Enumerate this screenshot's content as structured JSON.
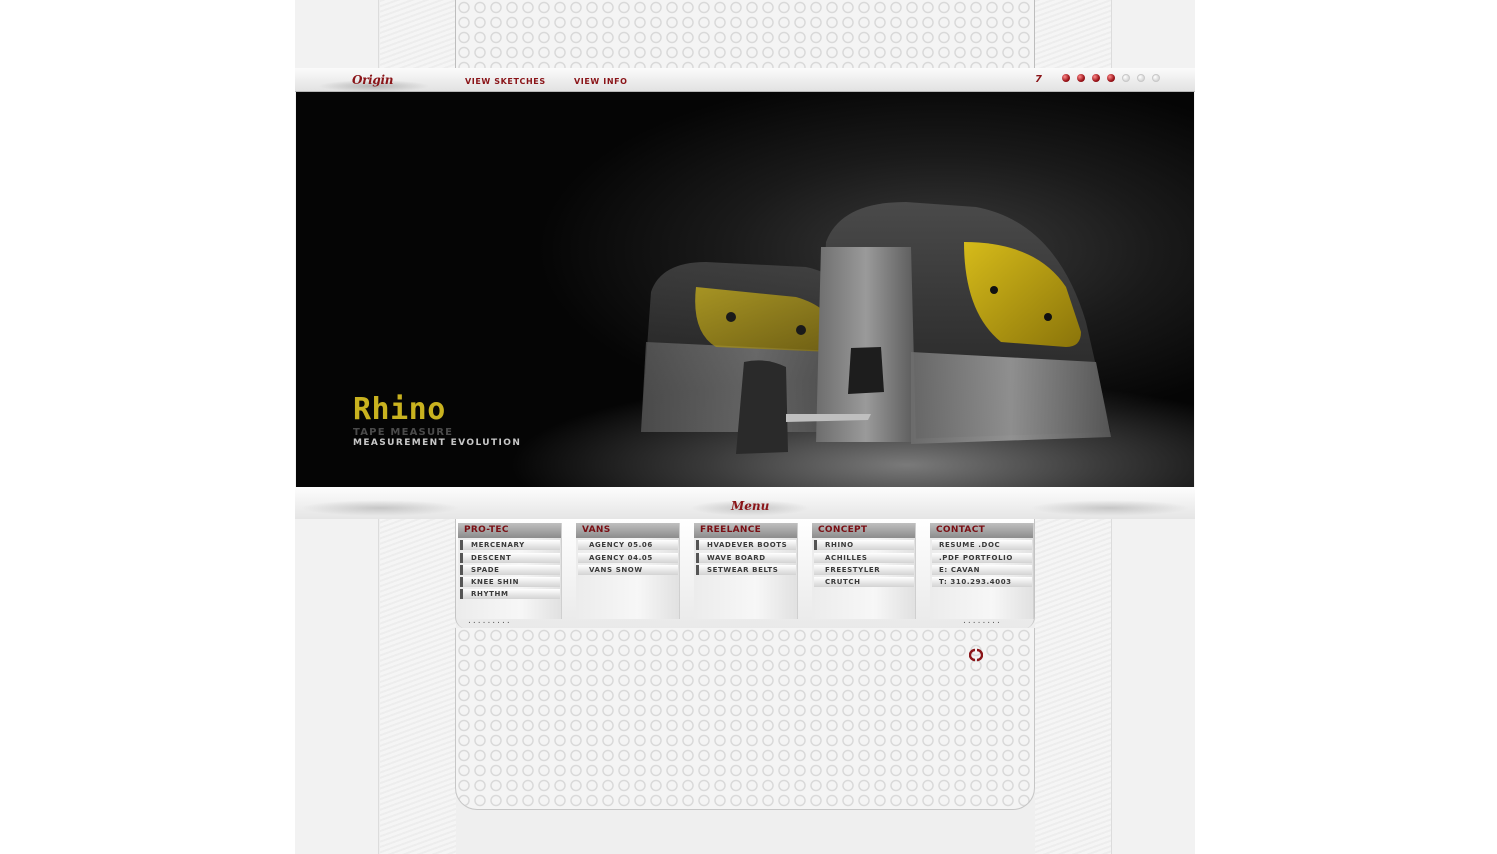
{
  "header": {
    "logo": "Origin",
    "nav": [
      "VIEW SKETCHES",
      "VIEW INFO"
    ],
    "page_number": "7",
    "pager": {
      "total": 7,
      "active": 4
    }
  },
  "hero": {
    "title": "Rhino",
    "subtitle": "TAPE MEASURE",
    "tagline": "MEASUREMENT EVOLUTION"
  },
  "menu": {
    "logo": "Menu",
    "columns": [
      {
        "title": "PRO-TEC",
        "items": [
          "MERCENARY",
          "DESCENT",
          "SPADE",
          "KNEE SHIN",
          "RHYTHM"
        ]
      },
      {
        "title": "VANS",
        "items": [
          "AGENCY 05.06",
          "AGENCY 04.05",
          "VANS SNOW"
        ]
      },
      {
        "title": "FREELANCE",
        "items": [
          "HVADEVER BOOTS",
          "WAVE BOARD",
          "SETWEAR BELTS"
        ]
      },
      {
        "title": "CONCEPT",
        "items": [
          "RHINO",
          "ACHILLES",
          "FREESTYLER",
          "CRUTCH"
        ]
      },
      {
        "title": "CONTACT",
        "items": [
          "RESUME .DOC",
          ".PDF PORTFOLIO",
          "E: CAVAN",
          "T: 310.293.4003"
        ]
      }
    ],
    "dots_left": ".........",
    "dots_right": "........"
  },
  "colors": {
    "accent": "#8a1418",
    "hero_title": "#c9b21f",
    "product_yellow": "#b59b12"
  }
}
